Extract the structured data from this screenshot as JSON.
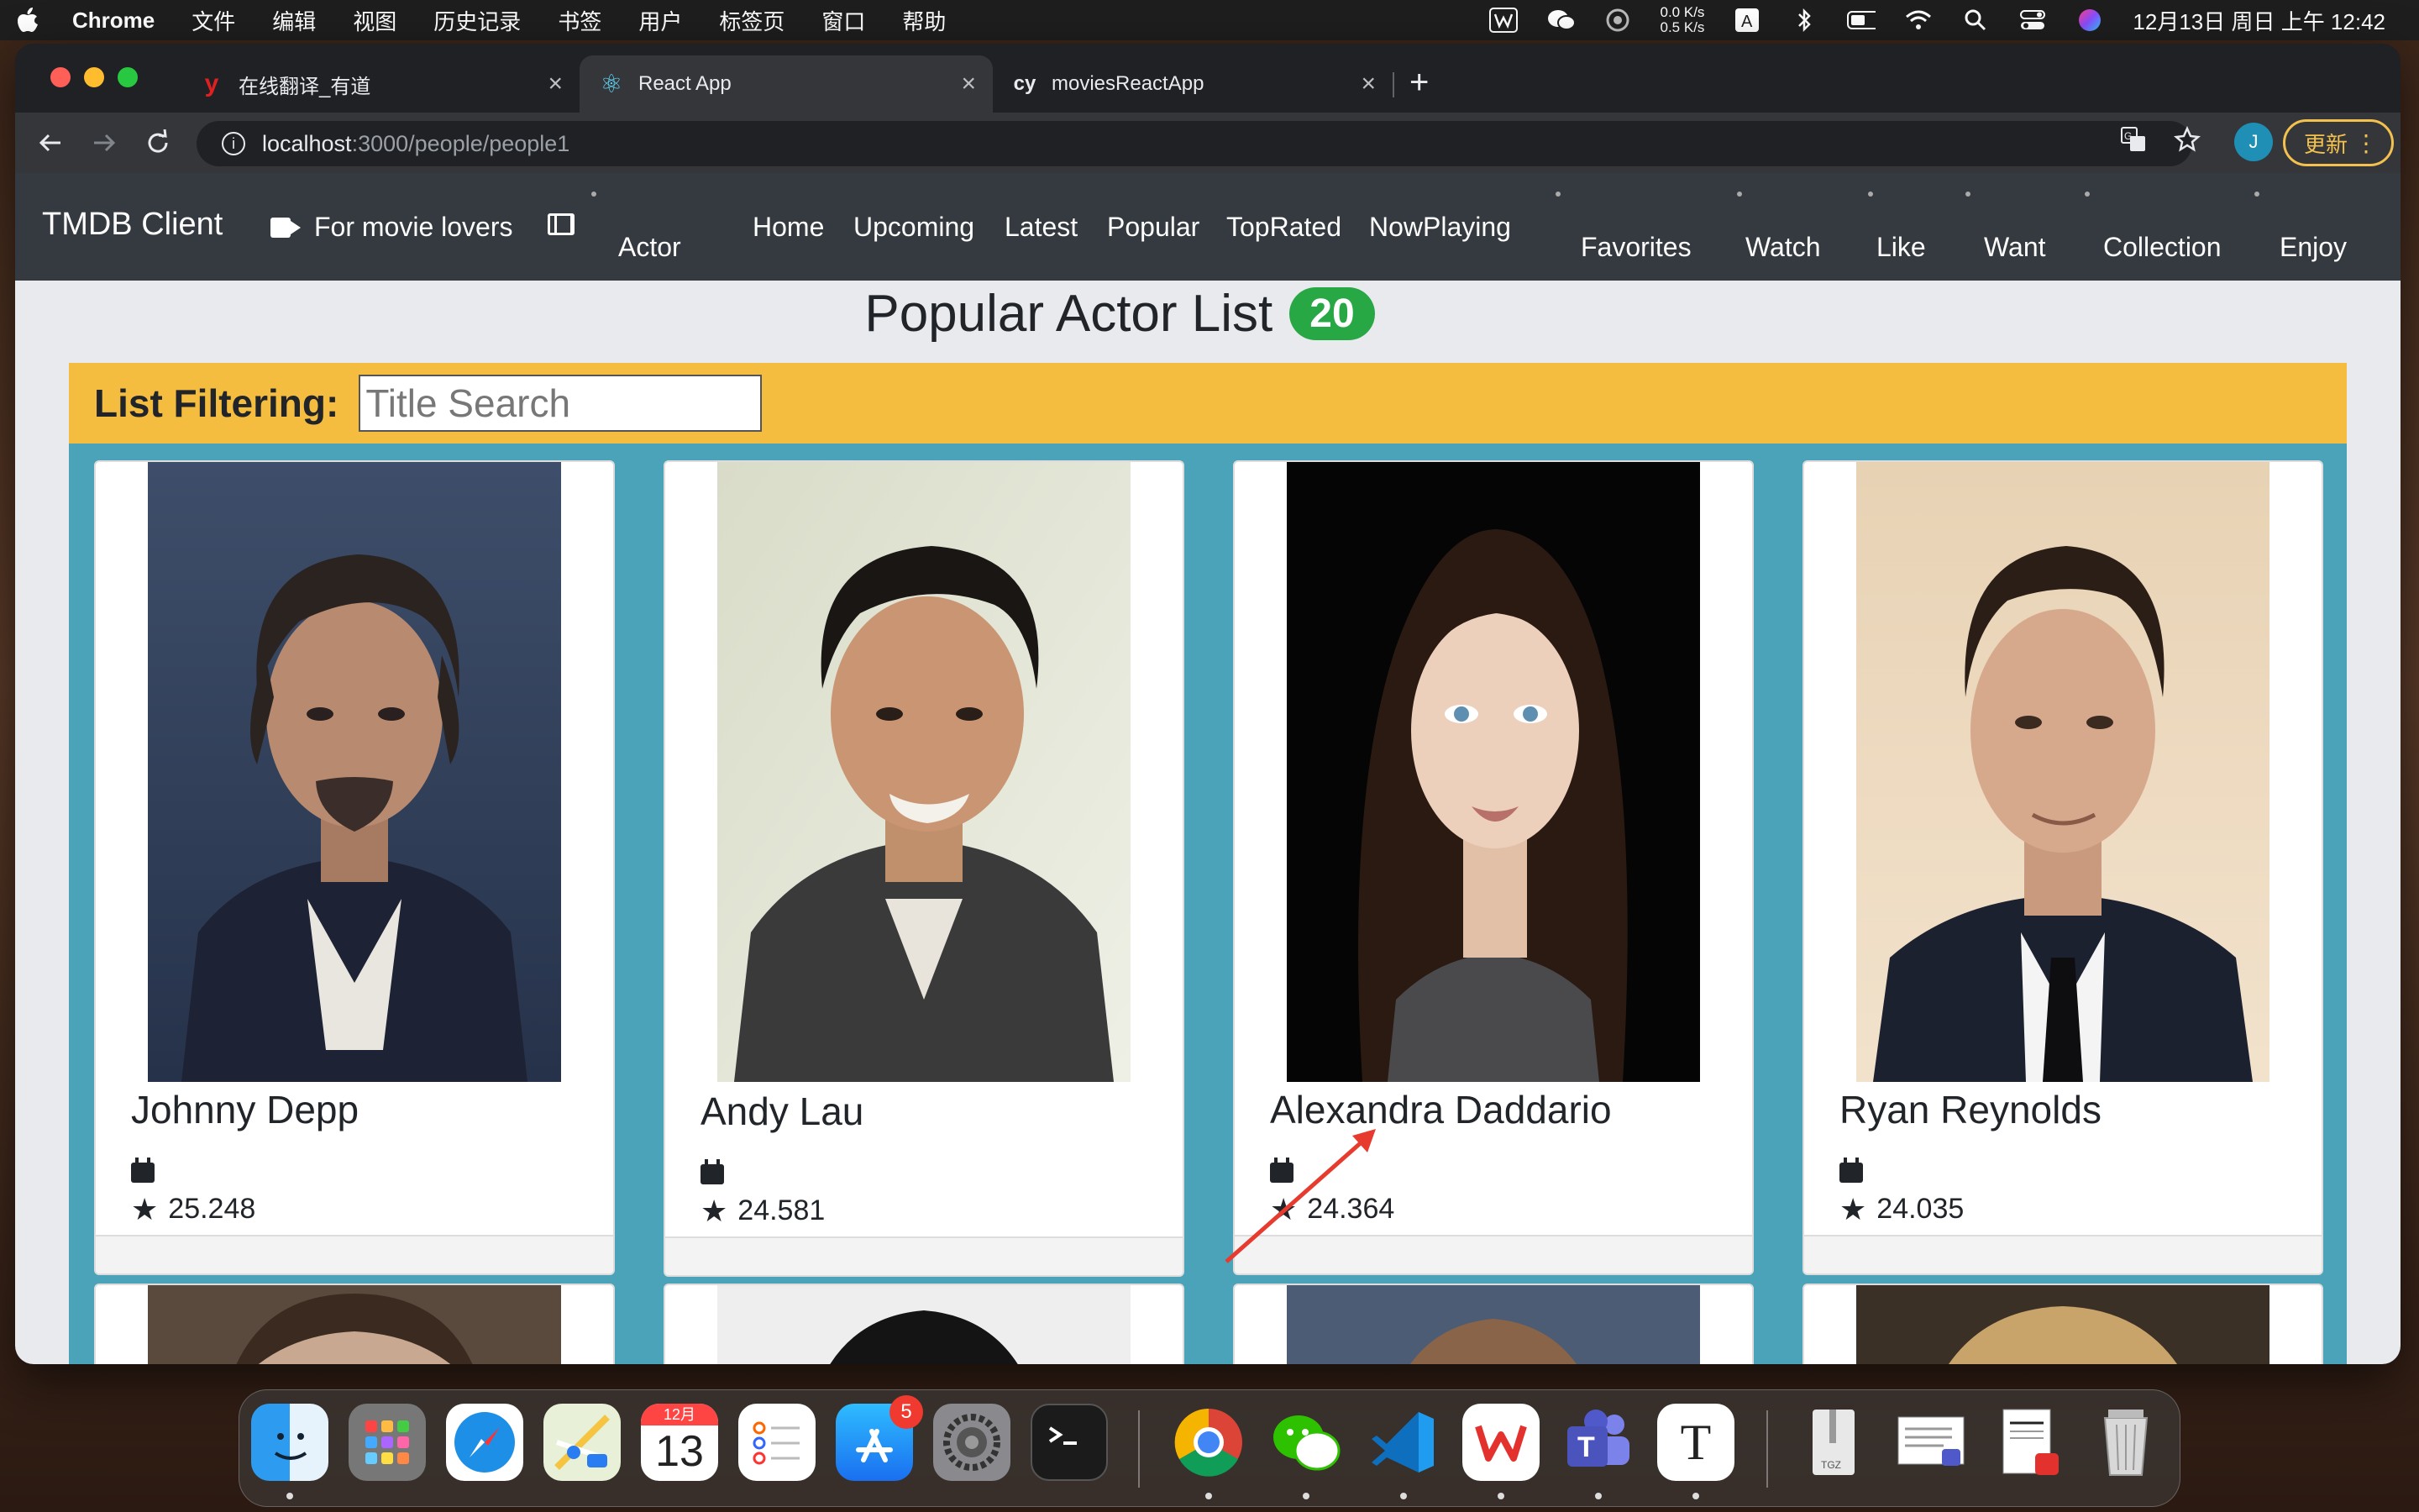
{
  "menubar": {
    "app_name": "Chrome",
    "items": [
      "文件",
      "编辑",
      "视图",
      "历史记录",
      "书签",
      "用户",
      "标签页",
      "窗口",
      "帮助"
    ],
    "net_up": "0.0 K/s",
    "net_down": "0.5 K/s",
    "clock": "12月13日 周日 上午 12:42"
  },
  "browser": {
    "tabs": [
      {
        "title": "在线翻译_有道",
        "icon": "youdao-icon",
        "icon_text": "y"
      },
      {
        "title": "React App",
        "icon": "react-icon",
        "icon_text": "⚛"
      },
      {
        "title": "moviesReactApp",
        "icon": "cy-icon",
        "icon_text": "cy"
      }
    ],
    "url_host": "localhost",
    "url_path": ":3000/people/people1",
    "profile_initial": "J",
    "update_label": "更新"
  },
  "app": {
    "brand": "TMDB Client",
    "tagline": "For movie lovers",
    "nav": {
      "actor": "Actor",
      "home": "Home",
      "upcoming": "Upcoming",
      "latest": "Latest",
      "popular": "Popular",
      "top_rated": "TopRated",
      "now_playing": "NowPlaying",
      "favorites": "Favorites",
      "watch": "Watch",
      "like": "Like",
      "want": "Want",
      "collection": "Collection",
      "enjoy": "Enjoy"
    },
    "page_title": "Popular Actor List",
    "count": "20",
    "filter_label": "List Filtering:",
    "search_placeholder": "Title Search",
    "actors": [
      {
        "name": "Johnny Depp",
        "popularity": "25.248"
      },
      {
        "name": "Andy Lau",
        "popularity": "24.581"
      },
      {
        "name": "Alexandra Daddario",
        "popularity": "24.364"
      },
      {
        "name": "Ryan Reynolds",
        "popularity": "24.035"
      }
    ]
  },
  "dock": {
    "items": [
      "finder-icon",
      "launchpad-icon",
      "safari-icon",
      "maps-icon",
      "calendar-icon",
      "reminders-icon",
      "app-store-icon",
      "system-preferences-icon",
      "terminal-icon",
      "chrome-icon",
      "wechat-icon",
      "vscode-icon",
      "wps-icon",
      "teams-icon",
      "typora-icon",
      "archive-icon",
      "documents-icon",
      "wps-document-icon",
      "trash-icon"
    ],
    "calendar_month": "12月",
    "calendar_day": "13",
    "app_store_badge": "5"
  },
  "colors": {
    "navbar": "#343a40",
    "filter_bar": "#f5bd40",
    "grid_bg": "#4aa3b8",
    "badge": "#28a745",
    "annotation": "#e63b2e"
  }
}
